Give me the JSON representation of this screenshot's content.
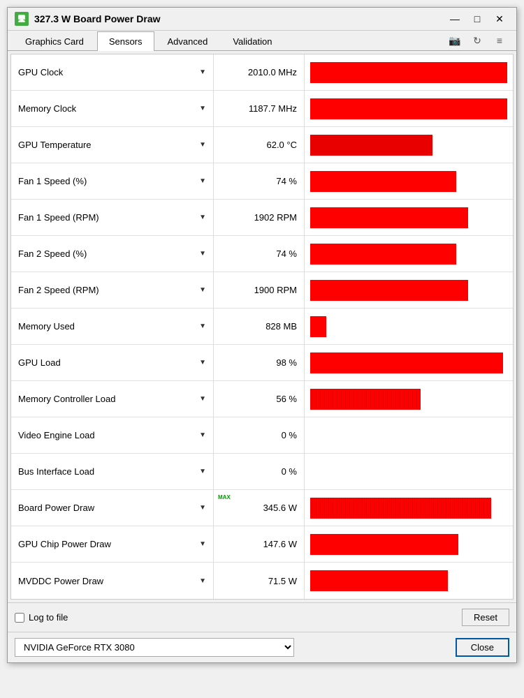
{
  "titleBar": {
    "icon": "GPU",
    "title": "327.3 W Board Power Draw",
    "minimizeLabel": "—",
    "maximizeLabel": "□",
    "closeLabel": "✕"
  },
  "tabs": [
    {
      "id": "graphics-card",
      "label": "Graphics Card",
      "active": false
    },
    {
      "id": "sensors",
      "label": "Sensors",
      "active": true
    },
    {
      "id": "advanced",
      "label": "Advanced",
      "active": false
    },
    {
      "id": "validation",
      "label": "Validation",
      "active": false
    }
  ],
  "tabIcons": {
    "camera": "📷",
    "refresh": "↻",
    "menu": "≡"
  },
  "sensors": [
    {
      "name": "GPU Clock",
      "value": "2010.0 MHz",
      "barPercent": 100,
      "barType": "solid",
      "maxLabel": false
    },
    {
      "name": "Memory Clock",
      "value": "1187.7 MHz",
      "barPercent": 100,
      "barType": "solid",
      "maxLabel": false
    },
    {
      "name": "GPU Temperature",
      "value": "62.0 °C",
      "barPercent": 62,
      "barType": "temp",
      "maxLabel": false
    },
    {
      "name": "Fan 1 Speed (%)",
      "value": "74 %",
      "barPercent": 74,
      "barType": "solid",
      "maxLabel": false
    },
    {
      "name": "Fan 1 Speed (RPM)",
      "value": "1902 RPM",
      "barPercent": 80,
      "barType": "solid",
      "maxLabel": false
    },
    {
      "name": "Fan 2 Speed (%)",
      "value": "74 %",
      "barPercent": 74,
      "barType": "solid",
      "maxLabel": false
    },
    {
      "name": "Fan 2 Speed (RPM)",
      "value": "1900 RPM",
      "barPercent": 80,
      "barType": "solid",
      "maxLabel": false
    },
    {
      "name": "Memory Used",
      "value": "828 MB",
      "barPercent": 8,
      "barType": "solid",
      "maxLabel": false
    },
    {
      "name": "GPU Load",
      "value": "98 %",
      "barPercent": 98,
      "barType": "solid",
      "maxLabel": false
    },
    {
      "name": "Memory Controller Load",
      "value": "56 %",
      "barPercent": 56,
      "barType": "noisy",
      "maxLabel": false
    },
    {
      "name": "Video Engine Load",
      "value": "0 %",
      "barPercent": 0,
      "barType": "solid",
      "maxLabel": false
    },
    {
      "name": "Bus Interface Load",
      "value": "0 %",
      "barPercent": 0,
      "barType": "solid",
      "maxLabel": false
    },
    {
      "name": "Board Power Draw",
      "value": "345.6 W",
      "barPercent": 92,
      "barType": "noisy",
      "maxLabel": true
    },
    {
      "name": "GPU Chip Power Draw",
      "value": "147.6 W",
      "barPercent": 75,
      "barType": "solid",
      "maxLabel": false
    },
    {
      "name": "MVDDC Power Draw",
      "value": "71.5 W",
      "barPercent": 70,
      "barType": "solid",
      "maxLabel": false
    }
  ],
  "footer": {
    "logCheckLabel": "Log to file",
    "resetLabel": "Reset"
  },
  "bottomBar": {
    "gpuName": "NVIDIA GeForce RTX 3080",
    "closeLabel": "Close"
  }
}
